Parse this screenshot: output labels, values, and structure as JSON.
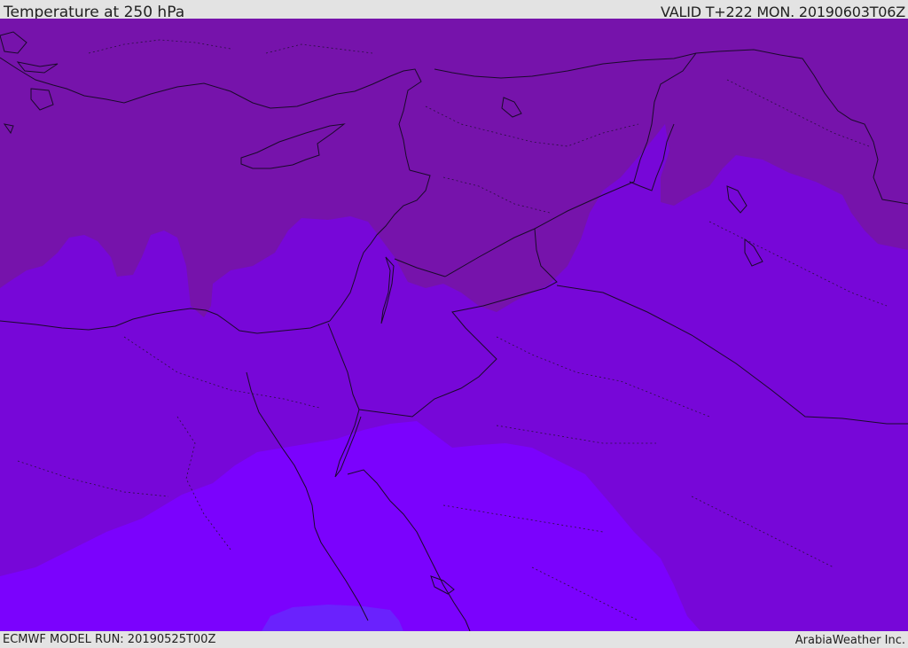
{
  "header": {
    "title": "Temperature at 250 hPa",
    "valid_time": "VALID T+222 MON. 20190603T06Z"
  },
  "footer": {
    "model_run": "ECMWF MODEL RUN: 20190525T00Z",
    "credit": "ArabiaWeather Inc."
  },
  "map": {
    "layers": [
      "temperature-fill",
      "coastlines",
      "country-borders",
      "province-borders"
    ],
    "colors": {
      "band_cold": "#7613ab",
      "band_mid": "#7707d8",
      "band_warm": "#7b02fd",
      "band_warmest": "#6a22fd",
      "coastline": "#1a0a2a",
      "border": "#1a0a2a"
    }
  }
}
